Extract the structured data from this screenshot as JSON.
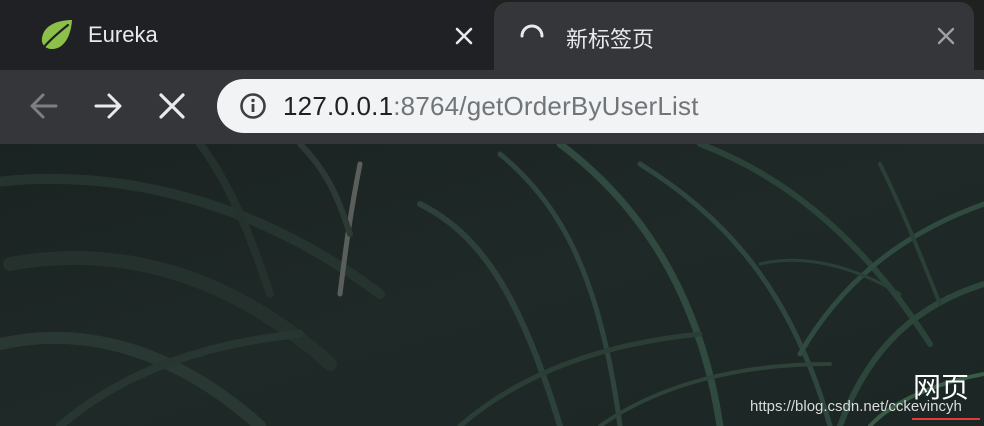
{
  "browser": {
    "tabs": [
      {
        "title": "Eureka",
        "favicon": "spring-leaf-icon",
        "state": "inactive"
      },
      {
        "title": "新标签页",
        "favicon": "loading-spinner-icon",
        "state": "active-loading"
      }
    ],
    "toolbar": {
      "back_icon": "arrow-left-icon",
      "forward_icon": "arrow-right-icon",
      "stop_icon": "close-icon",
      "site_info_icon": "info-icon"
    },
    "address_bar": {
      "host": "127.0.0.1",
      "path": ":8764/getOrderByUserList"
    }
  },
  "page": {
    "background": "dark green palm leaves",
    "watermark_title": "网页",
    "watermark_url": "https://blog.csdn.net/cckevincyh"
  },
  "colors": {
    "tabstrip": "#202124",
    "active_tab": "#35363a",
    "omnibox": "#f1f3f4",
    "leaf_green": "#8cc04a",
    "page_bg": "#1d2624",
    "watermark_underline": "#e23b3b"
  }
}
